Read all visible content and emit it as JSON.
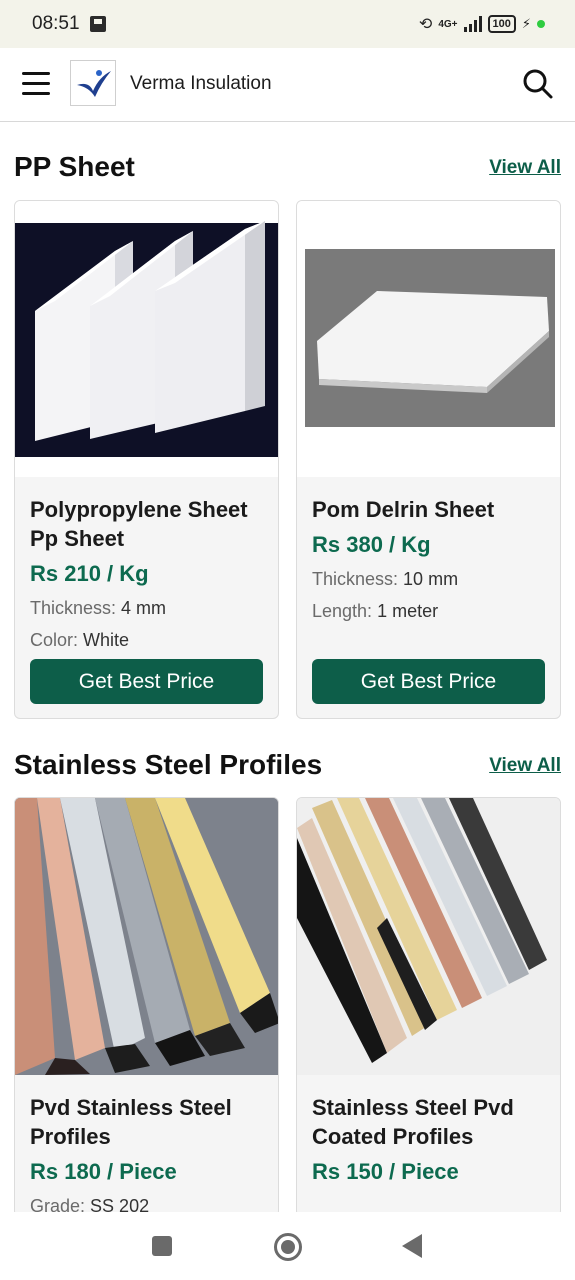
{
  "status_bar": {
    "time": "08:51",
    "network": "4G+",
    "battery": "100"
  },
  "header": {
    "brand": "Verma Insulation",
    "icons": [
      "menu-icon",
      "logo",
      "search-icon"
    ]
  },
  "sections": [
    {
      "title": "PP Sheet",
      "view_all": "View All",
      "products": [
        {
          "name": "Polypropylene Sheet Pp Sheet",
          "price": "Rs 210 / Kg",
          "specs": [
            {
              "key": "Thickness:",
              "value": "4 mm"
            },
            {
              "key": "Color:",
              "value": "White"
            }
          ],
          "cta": "Get Best Price"
        },
        {
          "name": "Pom Delrin Sheet",
          "price": "Rs 380 / Kg",
          "specs": [
            {
              "key": "Thickness:",
              "value": "10 mm"
            },
            {
              "key": "Length:",
              "value": "1 meter"
            }
          ],
          "cta": "Get Best Price"
        }
      ]
    },
    {
      "title": "Stainless Steel Profiles",
      "view_all": "View All",
      "products": [
        {
          "name": "Pvd Stainless Steel Profiles",
          "price": "Rs 180 / Piece",
          "specs": [
            {
              "key": "Grade:",
              "value": "SS 202"
            }
          ]
        },
        {
          "name": "Stainless Steel Pvd Coated Profiles",
          "price": "Rs 150 / Piece"
        }
      ]
    }
  ],
  "colors": {
    "accent": "#0d5e49",
    "price": "#0d6a4f",
    "status_bar": "#f3f3ea"
  }
}
